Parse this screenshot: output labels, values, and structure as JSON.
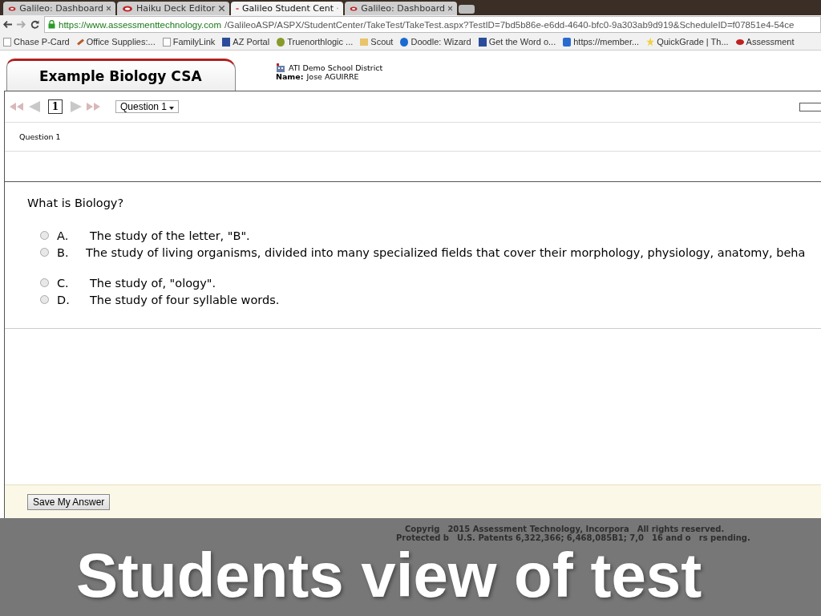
{
  "browser": {
    "tabs": [
      {
        "label": "Galileo: Dashboard",
        "selected": false
      },
      {
        "label": "Haiku Deck Editor",
        "selected": false
      },
      {
        "label": "Galileo Student Cent",
        "selected": true
      },
      {
        "label": "Galileo: Dashboard",
        "selected": false
      }
    ],
    "url_host": "https://www.assessmenttechnology.com",
    "url_path": "/GalileoASP/ASPX/StudentCenter/TakeTest/TakeTest.aspx?TestID=7bd5b86e-e6dd-4640-bfc0-9a303ab9d919&ScheduleID=f07851e4-54ce",
    "bookmarks": [
      {
        "label": "Chase P-Card",
        "kind": "page"
      },
      {
        "label": "Office Supplies:...",
        "kind": "pen"
      },
      {
        "label": "FamilyLink",
        "kind": "page"
      },
      {
        "label": "AZ Portal",
        "kind": "square"
      },
      {
        "label": "Truenorthlogic ...",
        "kind": "leaf"
      },
      {
        "label": "Scout",
        "kind": "folder"
      },
      {
        "label": "Doodle: Wizard",
        "kind": "d"
      },
      {
        "label": "Get the Word o...",
        "kind": "square"
      },
      {
        "label": "https://member...",
        "kind": "cross"
      },
      {
        "label": "QuickGrade | Th...",
        "kind": "star"
      },
      {
        "label": "Assessment",
        "kind": "eye"
      }
    ]
  },
  "test": {
    "title": "Example Biology CSA",
    "district": "ATI Demo School District",
    "name_label": "Name:",
    "name": "Jose AGUIRRE",
    "page_number": "1",
    "question_select": "Question 1",
    "question_label": "Question 1",
    "question": "What is Biology?",
    "answers": [
      {
        "letter": "A.",
        "text": "The study of the letter, \"B\".",
        "selected": false
      },
      {
        "letter": "B.",
        "text": "The study of living organisms, divided into many specialized fields that cover their morphology, physiology, anatomy, beha",
        "selected": false
      },
      {
        "letter": "C.",
        "text": "The study of, \"ology\".",
        "selected": false
      },
      {
        "letter": "D.",
        "text": "The study of four syllable words.",
        "selected": false
      }
    ],
    "save_button": "Save My Answer",
    "footer_lines": [
      [
        "Copyrig",
        "2015 Assessment Technology, Incorpora",
        "All rights reserved."
      ],
      [
        "Protected b",
        "U.S. Patents 6,322,366; 6,468,085B1; 7,0",
        "16 and o",
        "rs pending."
      ]
    ]
  },
  "caption": "Students view of test"
}
